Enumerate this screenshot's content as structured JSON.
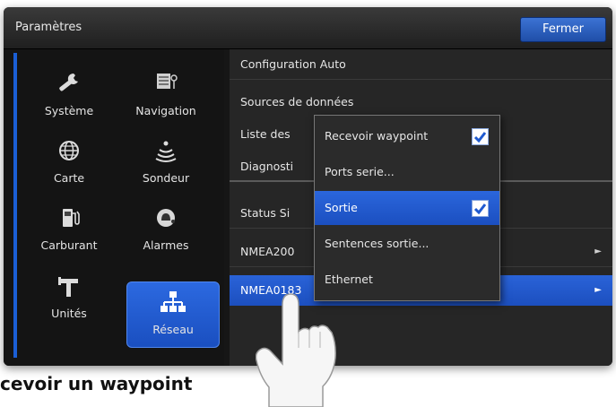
{
  "window": {
    "title": "Paramètres",
    "close_label": "Fermer"
  },
  "sidebar": {
    "items": [
      {
        "label": "Système",
        "icon": "wrench-icon",
        "selected": false
      },
      {
        "label": "Navigation",
        "icon": "navigation-icon",
        "selected": false
      },
      {
        "label": "Carte",
        "icon": "globe-icon",
        "selected": false
      },
      {
        "label": "Sondeur",
        "icon": "sonar-icon",
        "selected": false
      },
      {
        "label": "Carburant",
        "icon": "fuel-pump-icon",
        "selected": false
      },
      {
        "label": "Alarmes",
        "icon": "alarm-bell-icon",
        "selected": false
      },
      {
        "label": "Unités",
        "icon": "units-icon",
        "selected": false
      },
      {
        "label": "Réseau",
        "icon": "network-icon",
        "selected": true
      }
    ]
  },
  "menu": {
    "rows": [
      {
        "label": "Configuration Auto"
      },
      {
        "label": "Sources de données"
      },
      {
        "label": "Liste des"
      },
      {
        "label": "Diagnosti"
      },
      {
        "label": "Status Si"
      },
      {
        "label": "NMEA200",
        "has_submenu": true
      },
      {
        "label": "NMEA0183",
        "has_submenu": true,
        "selected": true
      }
    ]
  },
  "popup": {
    "items": [
      {
        "label": "Recevoir waypoint",
        "checked": true
      },
      {
        "label": "Ports serie..."
      },
      {
        "label": "Sortie",
        "checked": true,
        "selected": true
      },
      {
        "label": "Sentences sortie..."
      },
      {
        "label": "Ethernet"
      }
    ]
  },
  "caption": "cevoir un waypoint",
  "colors": {
    "accent": "#1f5ad0",
    "panel": "#262626",
    "background": "#161616"
  }
}
